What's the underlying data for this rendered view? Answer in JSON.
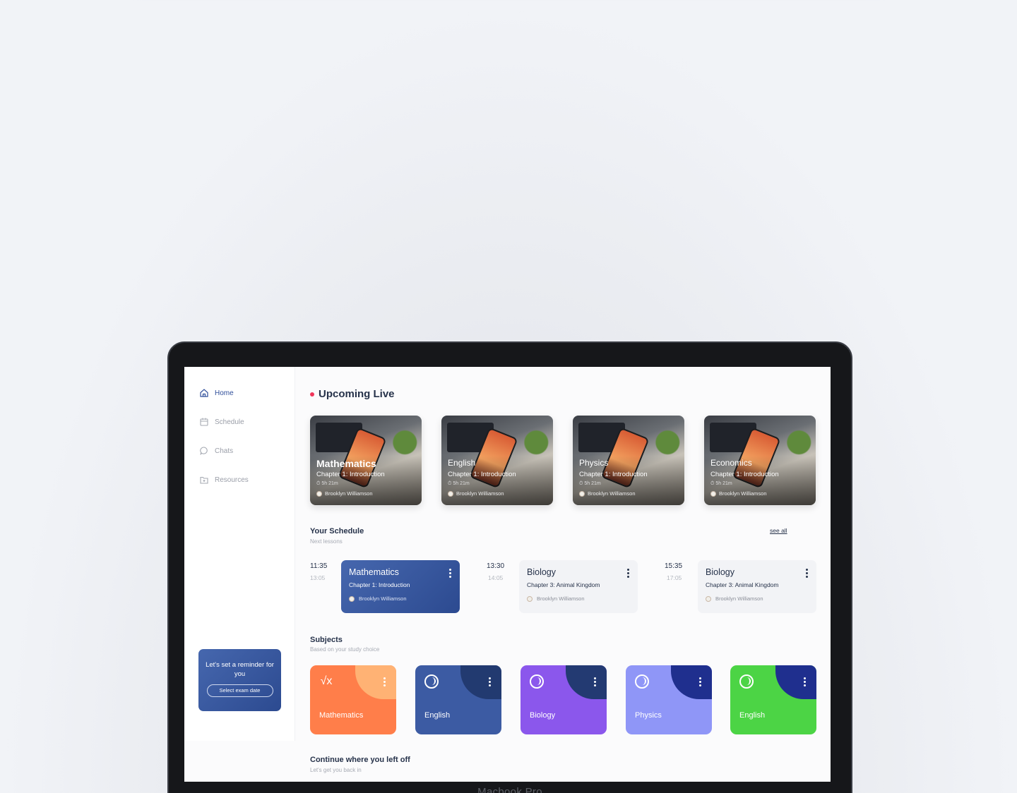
{
  "device_label": "Macbook Pro",
  "sidebar": {
    "items": [
      {
        "label": "Home",
        "icon": "home-icon",
        "active": true
      },
      {
        "label": "Schedule",
        "icon": "calendar-icon",
        "active": false
      },
      {
        "label": "Chats",
        "icon": "chat-icon",
        "active": false
      },
      {
        "label": "Resources",
        "icon": "folder-icon",
        "active": false
      }
    ],
    "reminder": {
      "title": "Let's set a reminder for you",
      "button": "Select exam date"
    }
  },
  "upcoming": {
    "title": "Upcoming Live",
    "cards": [
      {
        "subject": "Mathematics",
        "chapter": "Chapter 1: Introduction",
        "duration": "5h 21m",
        "teacher": "Brooklyn Williamson"
      },
      {
        "subject": "English",
        "chapter": "Chapter 1: Introduction",
        "duration": "5h 21m",
        "teacher": "Brooklyn Williamson"
      },
      {
        "subject": "Physics",
        "chapter": "Chapter 1: Introduction",
        "duration": "5h 21m",
        "teacher": "Brooklyn Williamson"
      },
      {
        "subject": "Economics",
        "chapter": "Chapter 1: Introduction",
        "duration": "5h 21m",
        "teacher": "Brooklyn Williamson"
      }
    ]
  },
  "schedule": {
    "title": "Your Schedule",
    "subtitle": "Next lessons",
    "see_all": "see all",
    "lessons": [
      {
        "start": "11:35",
        "end": "13:05",
        "subject": "Mathematics",
        "chapter": "Chapter 1: Introduction",
        "teacher": "Brooklyn Williamson",
        "active": true
      },
      {
        "start": "13:30",
        "end": "14:05",
        "subject": "Biology",
        "chapter": "Chapter 3: Animal Kingdom",
        "teacher": "Brooklyn Williamson",
        "active": false
      },
      {
        "start": "15:35",
        "end": "17:05",
        "subject": "Biology",
        "chapter": "Chapter 3: Animal Kingdom",
        "teacher": "Brooklyn Williamson",
        "active": false
      }
    ]
  },
  "subjects": {
    "title": "Subjects",
    "subtitle": "Based on your study choice",
    "items": [
      {
        "name": "Mathematics",
        "icon": "sqrt-icon",
        "color": "#ff7e4a",
        "accent": "#ffb274"
      },
      {
        "name": "English",
        "icon": "globe-icon",
        "color": "#3c5ba3",
        "accent": "#223a70"
      },
      {
        "name": "Biology",
        "icon": "globe-icon",
        "color": "#8b57ec",
        "accent": "#233a72"
      },
      {
        "name": "Physics",
        "icon": "globe-icon",
        "color": "#8f96f7",
        "accent": "#1f2f8e"
      },
      {
        "name": "English",
        "icon": "globe-icon",
        "color": "#4cd445",
        "accent": "#1f2f8e"
      }
    ]
  },
  "continue": {
    "title": "Continue where you left off",
    "subtitle": "Let's get you back in"
  }
}
